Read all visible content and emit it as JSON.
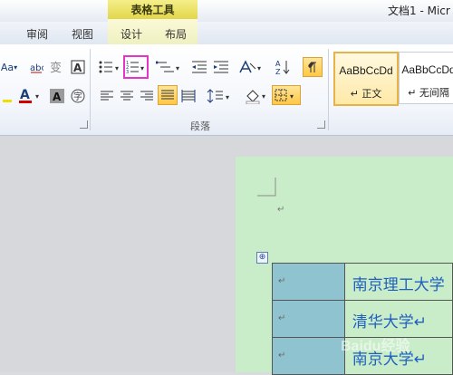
{
  "titlebar": {
    "context_header": "表格工具",
    "doc_title": "文档1 - Micr"
  },
  "tabs": {
    "review": "审阅",
    "view": "视图",
    "design": "设计",
    "layout": "布局"
  },
  "ribbon": {
    "font_aa": "Aa",
    "paragraph_group_label": "段落",
    "numbering_highlight_color": "#e633c8"
  },
  "styles": [
    {
      "sample": "AaBbCcDd",
      "name": "↵ 正文",
      "selected": true
    },
    {
      "sample": "AaBbCcDd",
      "name": "↵ 无间隔",
      "selected": false
    }
  ],
  "document": {
    "paragraph_mark": "↵",
    "table_move_handle": "⊕",
    "rows": [
      {
        "text": "南京理工大学"
      },
      {
        "text": "清华大学↵"
      },
      {
        "text": "南京大学↵"
      }
    ]
  },
  "watermark": "Baidu经验"
}
